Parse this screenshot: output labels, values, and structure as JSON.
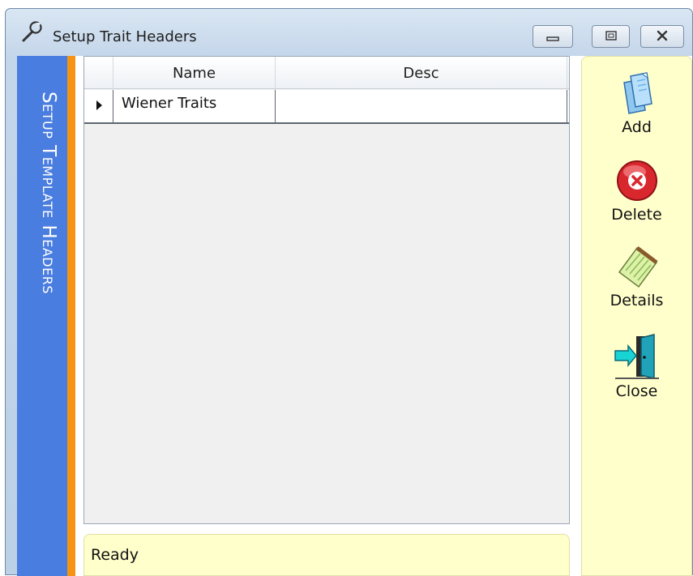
{
  "window": {
    "title": "Setup Trait Headers",
    "controls": {
      "minimize": "minimize",
      "maximize": "maximize",
      "close": "close"
    }
  },
  "sidebar": {
    "caption": "Setup Template Headers"
  },
  "grid": {
    "columns": [
      "Name",
      "Desc"
    ],
    "rows": [
      {
        "name": "Wiener Traits",
        "desc": ""
      }
    ]
  },
  "status": {
    "text": "Ready"
  },
  "actions": {
    "add": {
      "label": "Add",
      "icon": "add-documents-icon"
    },
    "delete": {
      "label": "Delete",
      "icon": "delete-x-icon"
    },
    "details": {
      "label": "Details",
      "icon": "notepad-icon"
    },
    "close": {
      "label": "Close",
      "icon": "exit-door-icon"
    }
  },
  "colors": {
    "sidebar": "#4a7de0",
    "stripe": "#f59412",
    "panel": "#ffffcc"
  }
}
